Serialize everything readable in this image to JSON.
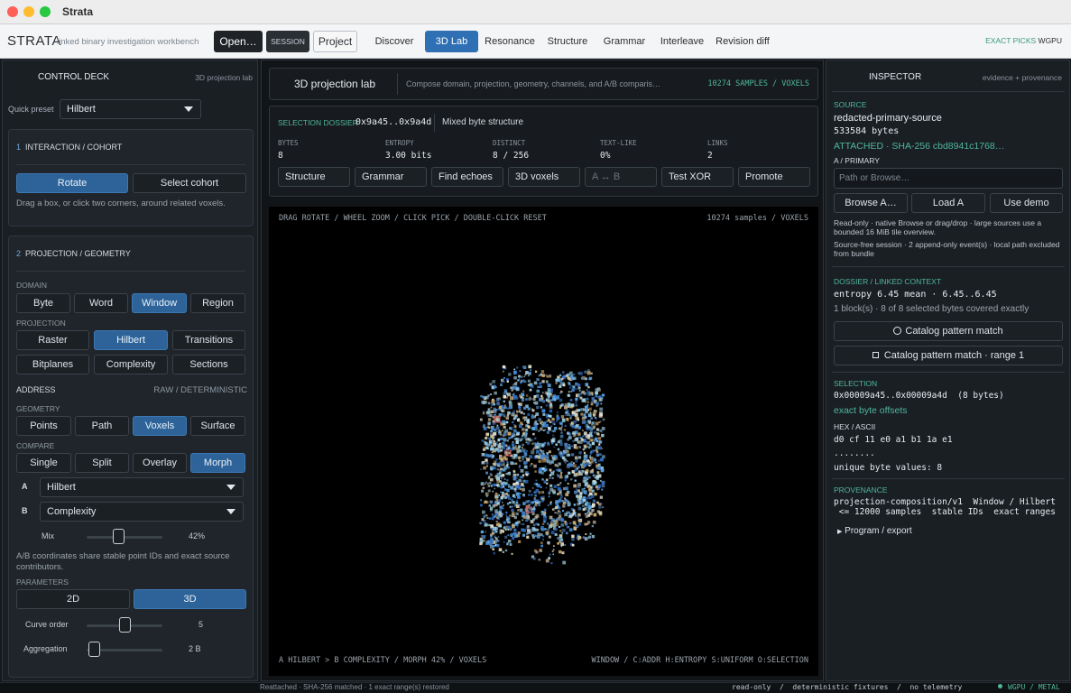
{
  "window": {
    "title": "Strata"
  },
  "appbar": {
    "brand": "STRATA",
    "brand_sub": "linked binary investigation workbench",
    "open_label": "Open…",
    "session_label": "SESSION",
    "project_label": "Project",
    "tabs": [
      "Discover",
      "3D Lab",
      "Resonance",
      "Structure",
      "Grammar",
      "Interleave",
      "Revision diff"
    ],
    "active_tab": "3D Lab",
    "exact_picks": "EXACT PICKS",
    "backend": "WGPU"
  },
  "left": {
    "title": "CONTROL DECK",
    "subtitle": "3D projection lab",
    "quick_preset_label": "Quick preset",
    "quick_preset_value": "Hilbert",
    "interaction": {
      "num": "1",
      "title": "INTERACTION / COHORT",
      "rotate": "Rotate",
      "select_cohort": "Select cohort",
      "hint": "Drag a box, or click two corners, around related voxels."
    },
    "projection": {
      "num": "2",
      "title": "PROJECTION / GEOMETRY",
      "domain_label": "DOMAIN",
      "domain": [
        "Byte",
        "Word",
        "Window",
        "Region"
      ],
      "projection_label": "PROJECTION",
      "projection_row1": [
        "Raster",
        "Hilbert",
        "Transitions"
      ],
      "projection_row2": [
        "Bitplanes",
        "Complexity",
        "Sections"
      ],
      "address_label": "ADDRESS",
      "address_value": "RAW / DETERMINISTIC",
      "geometry_label": "GEOMETRY",
      "geometry": [
        "Points",
        "Path",
        "Voxels",
        "Surface"
      ],
      "compare_label": "COMPARE",
      "compare": [
        "Single",
        "Split",
        "Overlay",
        "Morph"
      ],
      "a_label": "A",
      "a_value": "Hilbert",
      "b_label": "B",
      "b_value": "Complexity",
      "mix_label": "Mix",
      "mix_value": "42%",
      "mix_fraction": 0.42,
      "ab_note": "A/B coordinates share stable point IDs and exact source contributors.",
      "parameters_label": "PARAMETERS",
      "dims": [
        "2D",
        "3D"
      ],
      "curve_order_label": "Curve order",
      "curve_order_value": "5",
      "curve_order_fraction": 0.5,
      "aggregation_label": "Aggregation",
      "aggregation_value": "2 B",
      "aggregation_fraction": 0.1
    }
  },
  "mid": {
    "title": "3D projection lab",
    "subtitle": "Compose domain, projection, geometry, channels, and A/B comparis…",
    "samples": "10274 SAMPLES / VOXELS",
    "dossier": {
      "label": "SELECTION DOSSIER",
      "range": "0x9a45..0x9a4d",
      "structure": "Mixed byte structure",
      "stats": [
        {
          "k": "BYTES",
          "v": "8"
        },
        {
          "k": "ENTROPY",
          "v": "3.00 bits"
        },
        {
          "k": "DISTINCT",
          "v": "8 / 256"
        },
        {
          "k": "TEXT-LIKE",
          "v": "0%"
        },
        {
          "k": "LINKS",
          "v": "2"
        }
      ],
      "actions": [
        "Structure",
        "Grammar",
        "Find echoes",
        "3D voxels",
        "A ↔ B",
        "Test XOR",
        "Promote"
      ]
    },
    "viewport": {
      "hint": "DRAG ROTATE / WHEEL ZOOM / CLICK PICK / DOUBLE-CLICK RESET",
      "samples": "10274 samples / VOXELS",
      "footer_left": "A HILBERT > B COMPLEXITY / MORPH 42% / VOXELS",
      "footer_right": "WINDOW / C:ADDR H:ENTROPY S:UNIFORM O:SELECTION"
    }
  },
  "right": {
    "title": "INSPECTOR",
    "subtitle": "evidence + provenance",
    "source_label": "SOURCE",
    "source_name": "redacted-primary-source",
    "source_bytes": "533584 bytes",
    "attached": "ATTACHED · SHA-256 cbd8941c1768…",
    "slot_label": "A / PRIMARY",
    "path_placeholder": "Path or Browse…",
    "browse_label": "Browse A…",
    "load_label": "Load A",
    "demo_label": "Use demo",
    "readonly_note": "Read-only · native Browse or drag/drop · large sources use a bounded 16 MiB tile overview.",
    "session_note": "Source-free session · 2 append-only event(s) · local path excluded from bundle",
    "dossier_label": "DOSSIER / LINKED CONTEXT",
    "entropy_line": "entropy 6.45 mean · 6.45..6.45",
    "blocks_line": "1 block(s) · 8 of 8 selected bytes covered exactly",
    "catalog_match": "Catalog pattern match",
    "catalog_range": "Catalog pattern match · range 1",
    "selection_label": "SELECTION",
    "selection_range": "0x00009a45..0x00009a4d  (8 bytes)",
    "exact_offsets": "exact byte offsets",
    "hex_label": "HEX / ASCII",
    "hex_bytes": "d0 cf 11 e0 a1 b1 1a e1",
    "ascii": "........",
    "unique": "unique byte values: 8",
    "provenance_label": "PROVENANCE",
    "provenance_line1": "projection-composition/v1  Window / Hilbert",
    "provenance_line2": " <= 12000 samples  stable IDs  exact ranges",
    "program_export": "Program / export"
  },
  "status": {
    "left": "Reattached · SHA-256 matched · 1 exact range(s) restored",
    "right": "read-only  /  deterministic fixtures  /  no telemetry",
    "backend": "WGPU / METAL"
  },
  "colors": {
    "accent": "#2f6fb3",
    "teal": "#4fb79a",
    "panel": "#1a1f24",
    "viewport": "#000000"
  }
}
